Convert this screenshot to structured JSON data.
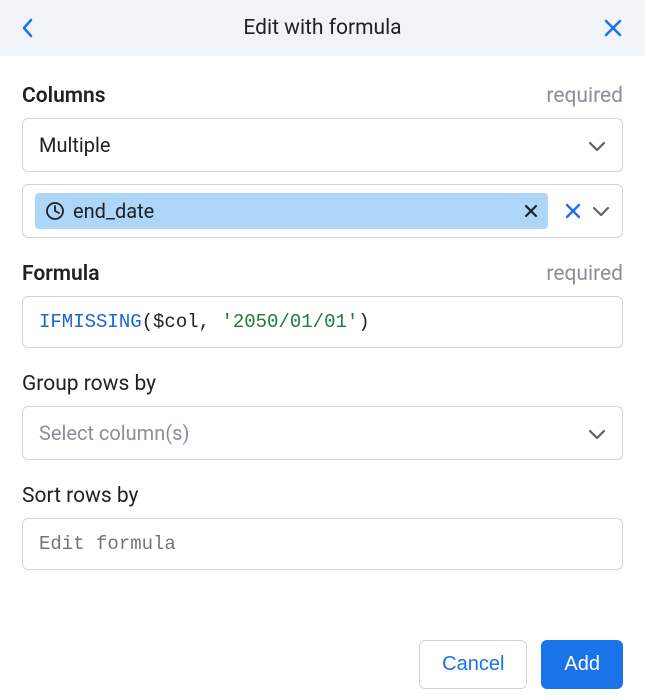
{
  "header": {
    "title": "Edit with formula"
  },
  "fields": {
    "columns": {
      "label": "Columns",
      "required": "required",
      "selector_value": "Multiple",
      "chip": {
        "label": "end_date"
      }
    },
    "formula": {
      "label": "Formula",
      "required": "required",
      "tokens": {
        "func": "IFMISSING",
        "lparen": "(",
        "var": "$col",
        "comma": ", ",
        "str": "'2050/01/01'",
        "rparen": ")"
      }
    },
    "groupby": {
      "label": "Group rows by",
      "placeholder": "Select column(s)"
    },
    "sortby": {
      "label": "Sort rows by",
      "placeholder": "Edit formula"
    }
  },
  "footer": {
    "cancel": "Cancel",
    "add": "Add"
  }
}
